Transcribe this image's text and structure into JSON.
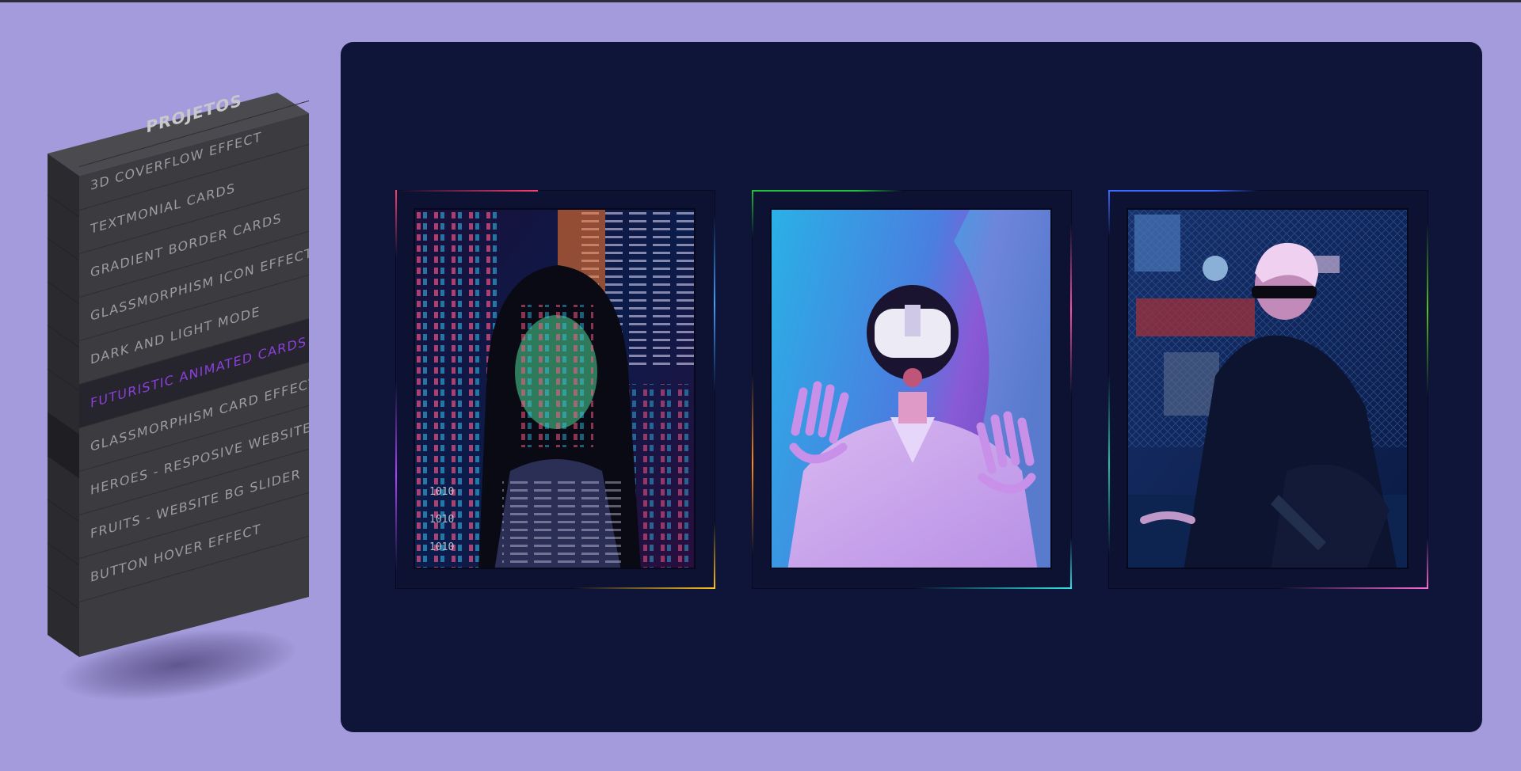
{
  "menu": {
    "title": "PROJETOS",
    "items": [
      {
        "label": "3D COVERFLOW EFFECT",
        "active": false
      },
      {
        "label": "TEXTMONIAL CARDS",
        "active": false
      },
      {
        "label": "GRADIENT BORDER CARDS",
        "active": false
      },
      {
        "label": "GLASSMORPHISM ICON EFFECT",
        "active": false
      },
      {
        "label": "DARK AND LIGHT MODE",
        "active": false
      },
      {
        "label": "FUTURISTIC ANIMATED CARDS",
        "active": true
      },
      {
        "label": "GLASSMORPHISM CARD EFFECT",
        "active": false
      },
      {
        "label": "HEROES - RESPOSIVE WEBSITE",
        "active": false
      },
      {
        "label": "FRUITS - WEBSITE BG SLIDER",
        "active": false
      },
      {
        "label": "BUTTON HOVER EFFECT",
        "active": false
      }
    ]
  },
  "cards": [
    {
      "photo": "woman-code-projection",
      "accent_colors": [
        "#ff3d6e",
        "#3aa0ff",
        "#b040ff",
        "#ffc21a"
      ]
    },
    {
      "photo": "person-vr-headset",
      "accent_colors": [
        "#1fc23a",
        "#ff4fa0",
        "#ff8a1a",
        "#2ee6e6"
      ]
    },
    {
      "photo": "cyberpunk-visor-figure",
      "accent_colors": [
        "#3a6aff",
        "#5ac21f",
        "#1fc2a0",
        "#ff6ad5"
      ]
    }
  ],
  "colors": {
    "page_bg": "#a39bdb",
    "panel_bg": "#0f1538",
    "menu_active_text": "#8b3fdc"
  }
}
